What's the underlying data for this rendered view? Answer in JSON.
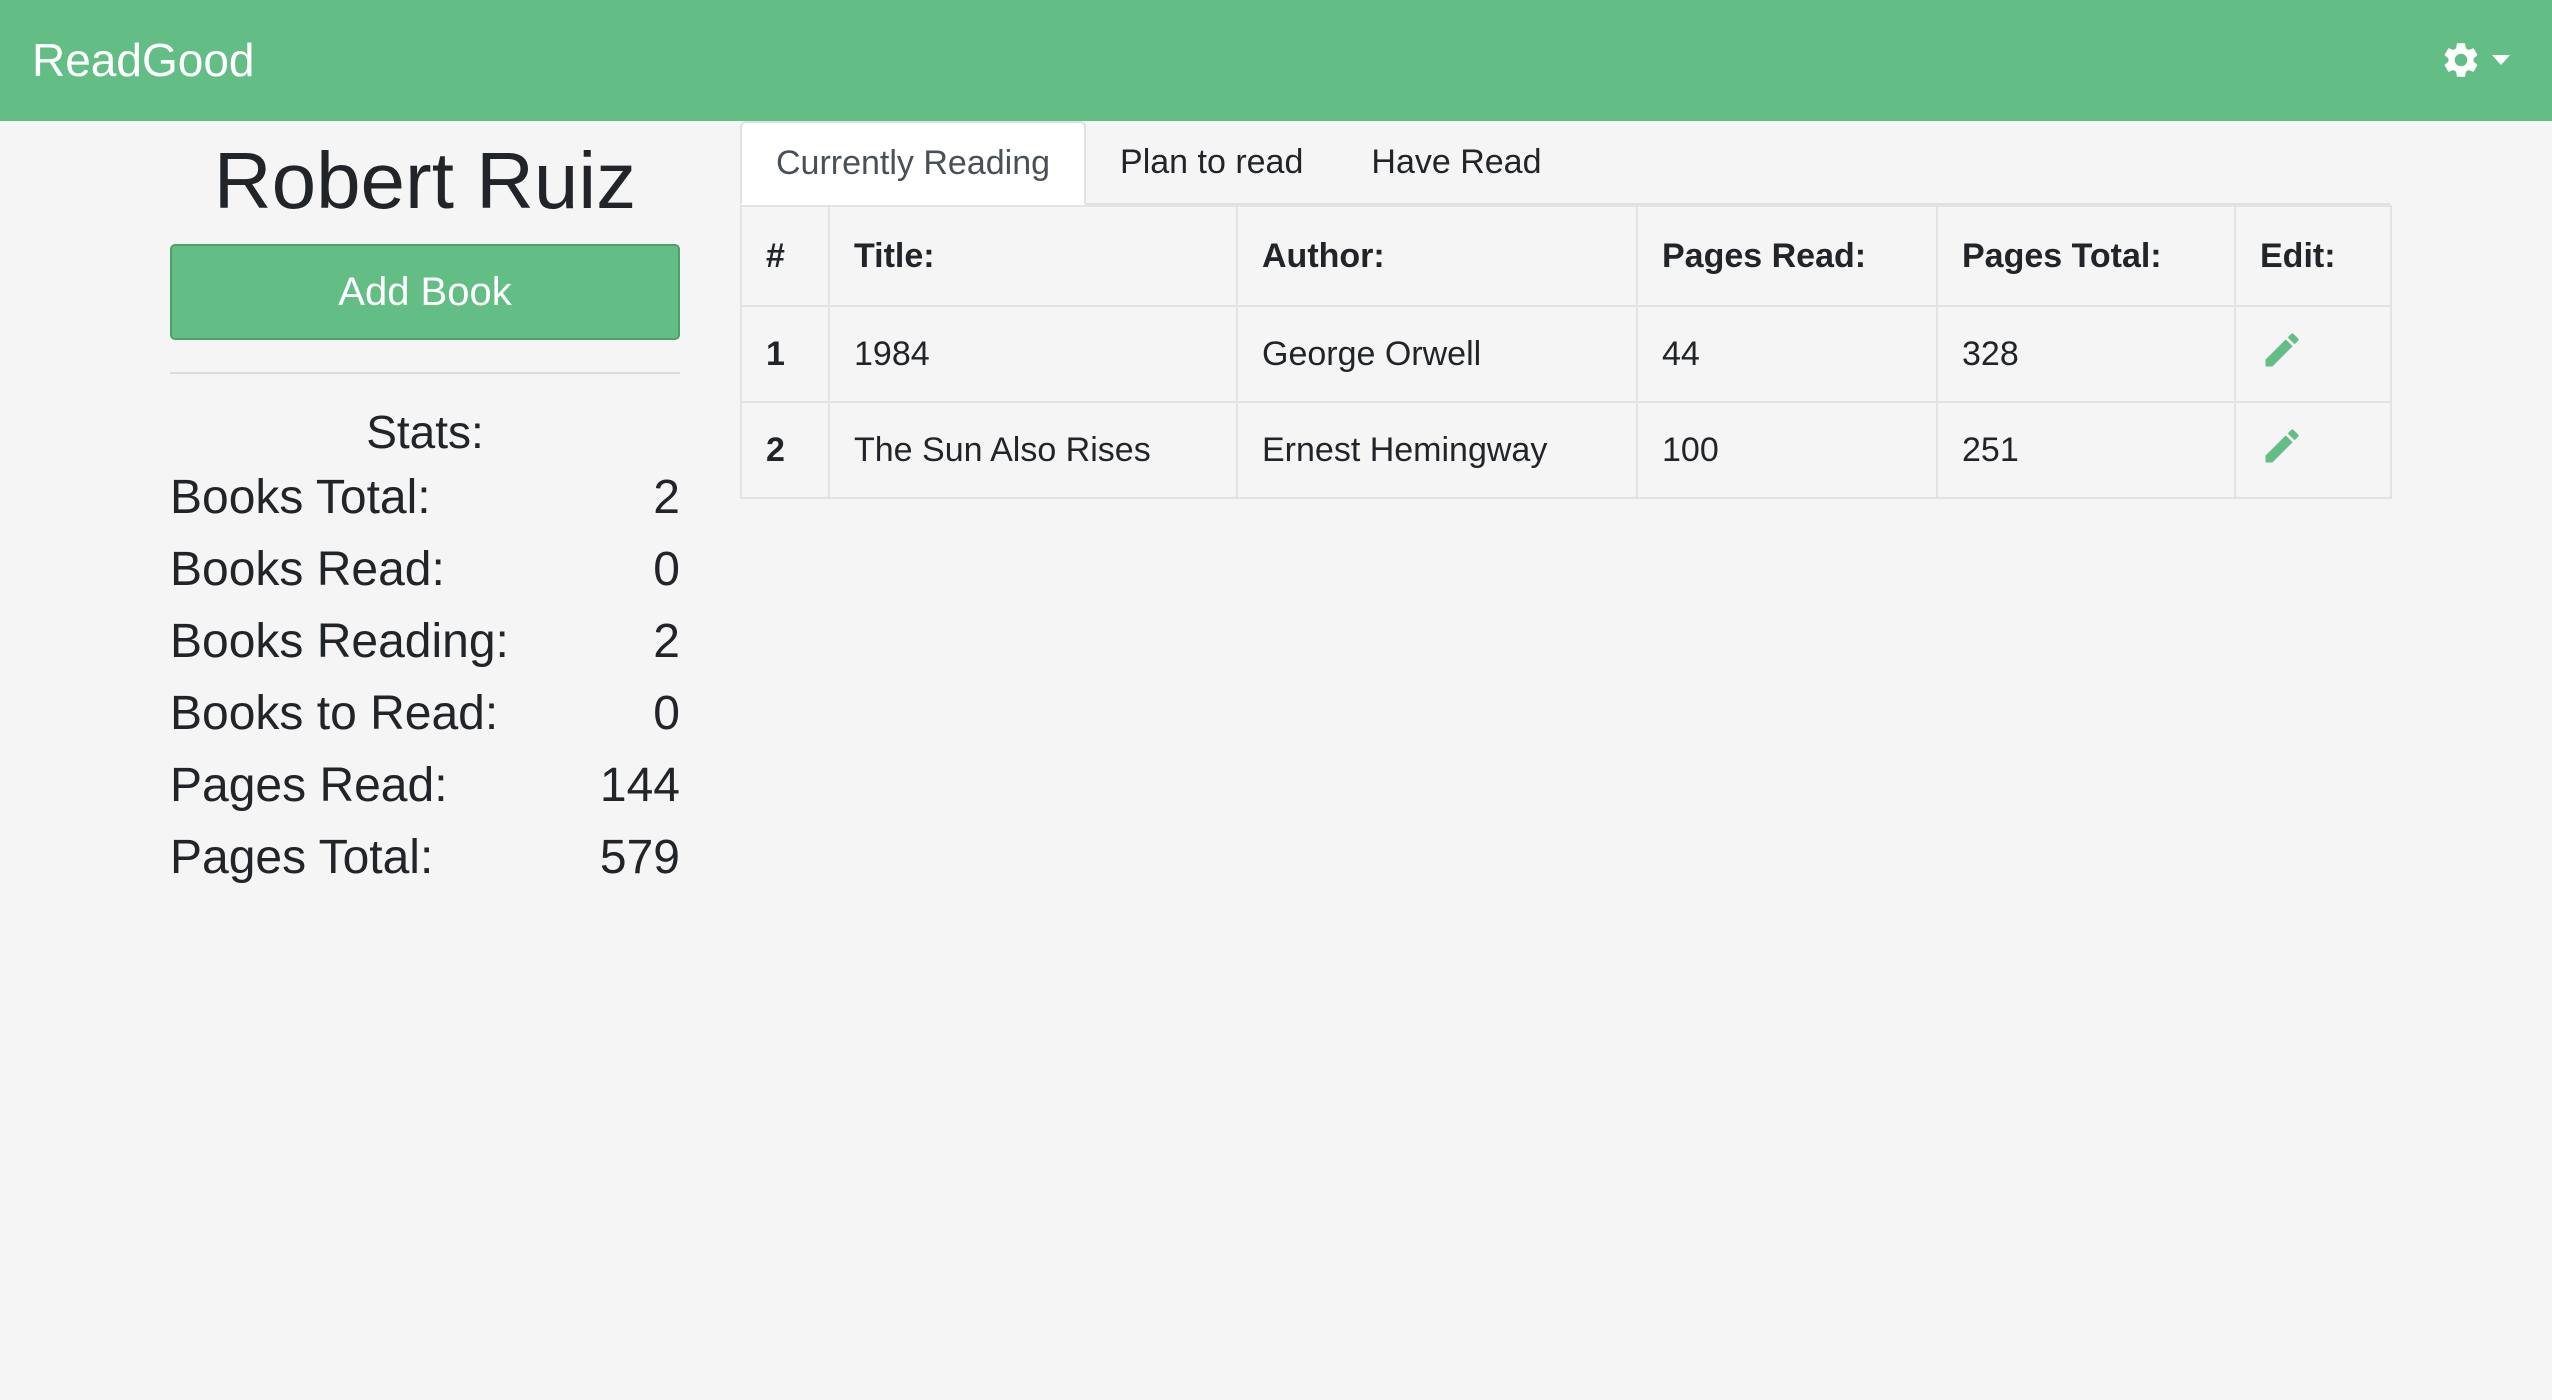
{
  "app": {
    "brand": "ReadGood",
    "accent_color": "#63be85",
    "settings_icon": "gear-icon"
  },
  "sidebar": {
    "user_name": "Robert Ruiz",
    "add_book_label": "Add Book",
    "stats_title": "Stats:",
    "stats": [
      {
        "label": "Books Total:",
        "value": "2"
      },
      {
        "label": "Books Read:",
        "value": "0"
      },
      {
        "label": "Books Reading:",
        "value": "2"
      },
      {
        "label": "Books to Read:",
        "value": "0"
      },
      {
        "label": "Pages Read:",
        "value": "144"
      },
      {
        "label": "Pages Total:",
        "value": "579"
      }
    ]
  },
  "tabs": [
    {
      "label": "Currently Reading",
      "active": true
    },
    {
      "label": "Plan to read",
      "active": false
    },
    {
      "label": "Have Read",
      "active": false
    }
  ],
  "table": {
    "headers": [
      "#",
      "Title:",
      "Author:",
      "Pages Read:",
      "Pages Total:",
      "Edit:"
    ],
    "rows": [
      {
        "num": "1",
        "title": "1984",
        "author": "George Orwell",
        "pages_read": "44",
        "pages_total": "328",
        "edit_icon": "pencil-icon"
      },
      {
        "num": "2",
        "title": "The Sun Also Rises",
        "author": "Ernest Hemingway",
        "pages_read": "100",
        "pages_total": "251",
        "edit_icon": "pencil-icon"
      }
    ]
  }
}
